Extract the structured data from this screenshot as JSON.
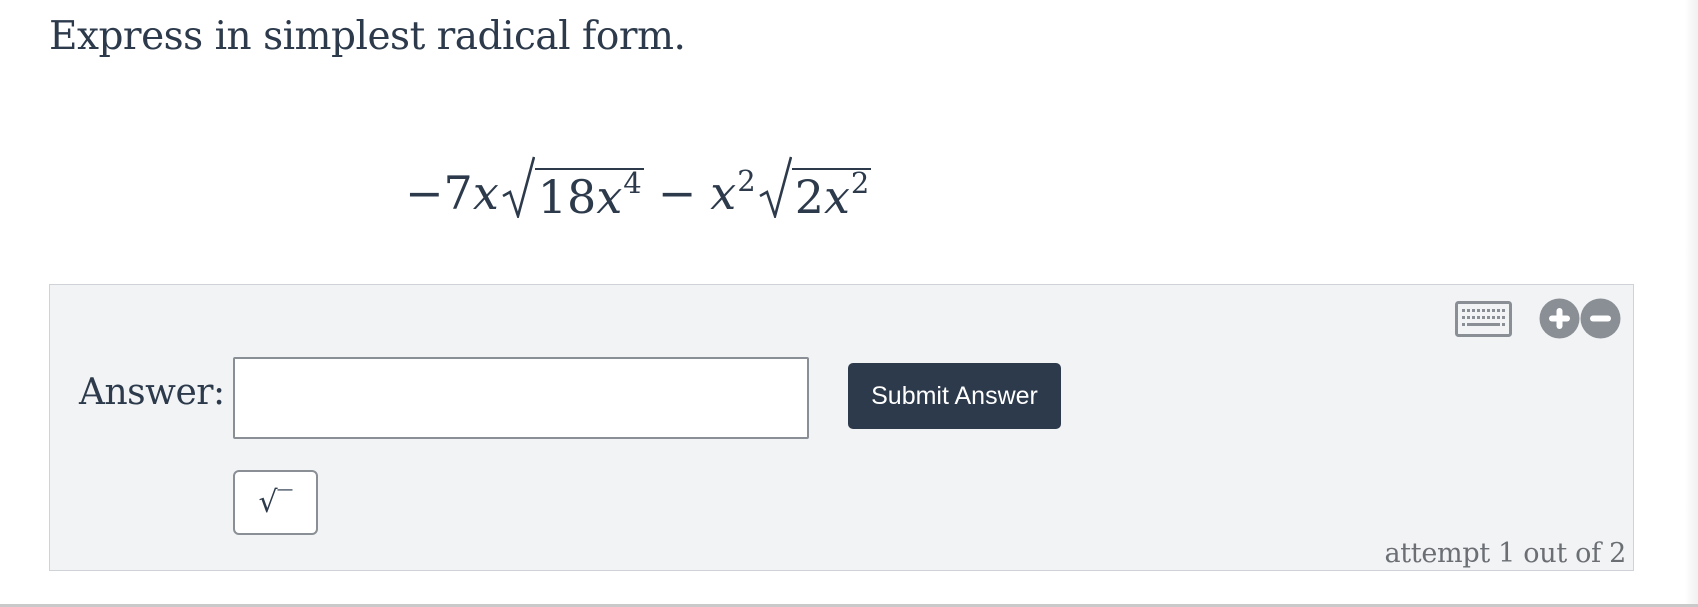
{
  "question": {
    "prompt": "Express in simplest radical form."
  },
  "expression": {
    "neg": "−",
    "coef1": "7",
    "var1": "x",
    "rad1_num": "18",
    "rad1_var": "x",
    "rad1_exp": "4",
    "op": "−",
    "var2": "x",
    "var2_exp": "2",
    "rad2_num": "2",
    "rad2_var": "x",
    "rad2_exp": "2"
  },
  "answer": {
    "label": "Answer:",
    "input_value": "",
    "submit_label": "Submit Answer",
    "sqrt_symbol": "√‾"
  },
  "tools": {
    "keyboard_icon": "keyboard-icon",
    "zoom_in_icon": "plus-circle-icon",
    "zoom_out_icon": "minus-circle-icon"
  },
  "status": {
    "attempt": "attempt 1 out of 2"
  },
  "colors": {
    "text": "#2c3a4b",
    "button_bg": "#2c3a4b",
    "panel_bg": "#f2f3f5",
    "icon_gray": "#8a8f96",
    "muted_text": "#6b6f74"
  }
}
